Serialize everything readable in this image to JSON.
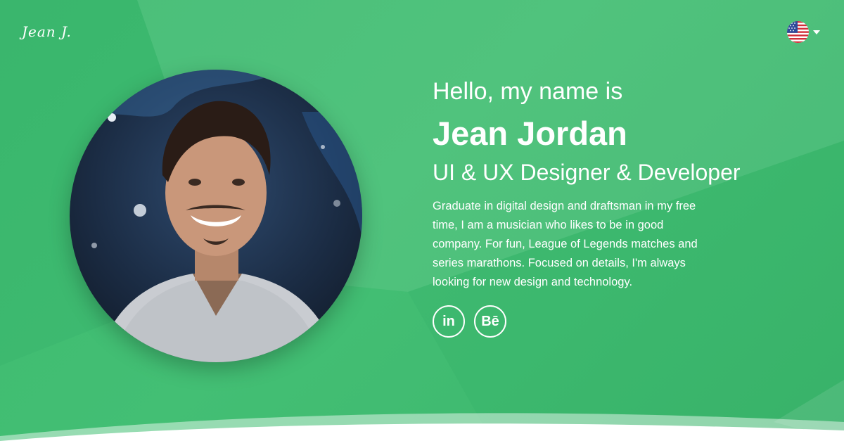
{
  "header": {
    "logo_text": "Jean J.",
    "language": {
      "current": "English (US)",
      "icon": "us-flag-icon"
    }
  },
  "hero": {
    "greeting": "Hello, my name is",
    "name": "Jean Jordan",
    "role": "UI & UX Designer & Developer",
    "bio": "Graduate in digital design and draftsman in my free time, I am a musician who likes to be in good company. For fun, League of Legends matches and series marathons. Focused on details, I'm always looking for new design and technology.",
    "portrait_icon": "profile-photo",
    "socials": [
      {
        "label": "in",
        "icon": "linkedin-icon"
      },
      {
        "label": "Bē",
        "icon": "behance-icon"
      }
    ]
  },
  "colors": {
    "primary_green": "#43bf74",
    "text": "#ffffff"
  }
}
